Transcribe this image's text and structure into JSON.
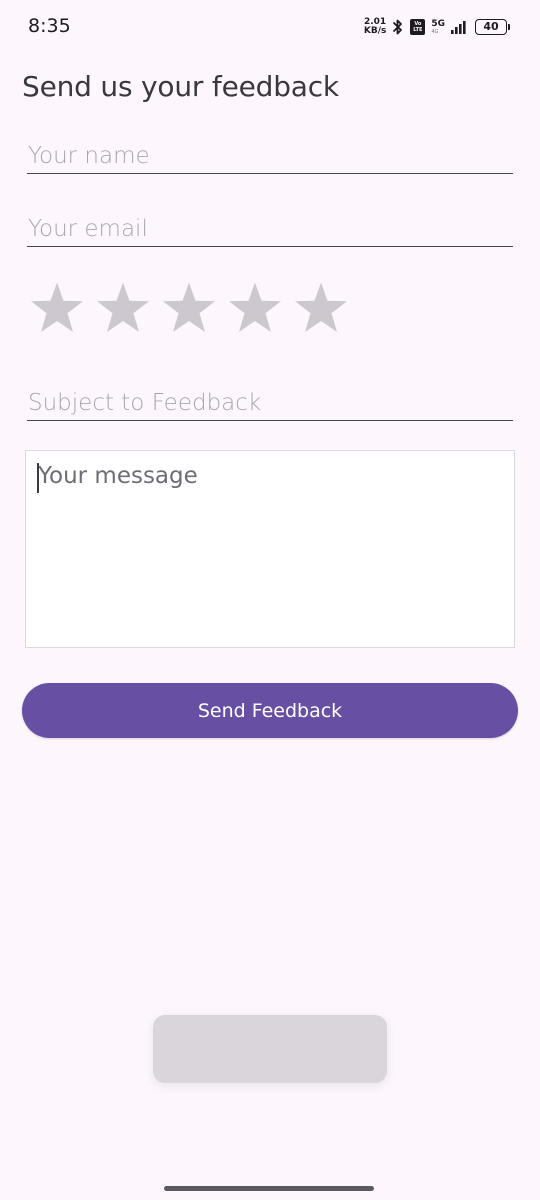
{
  "status_bar": {
    "time": "8:35",
    "net_speed_value": "2.01",
    "net_speed_unit": "KB/s",
    "volte_top": "Vo",
    "volte_bottom": "LTE",
    "network_type": "5G",
    "network_sub": "4G",
    "battery_level": "40",
    "icons": [
      "bluetooth-icon",
      "volte-icon",
      "signal-icon",
      "battery-icon"
    ]
  },
  "form": {
    "title": "Send us your feedback",
    "name_placeholder": "Your name",
    "email_placeholder": "Your email",
    "rating": {
      "max": 5,
      "value": 0,
      "empty_color": "#cdc8cf"
    },
    "subject_placeholder": "Subject to Feedback",
    "message_placeholder": "Your message",
    "send_label": "Send Feedback"
  },
  "colors": {
    "background": "#fdf6fd",
    "accent": "#6750a4",
    "toast": "#dad5db"
  }
}
